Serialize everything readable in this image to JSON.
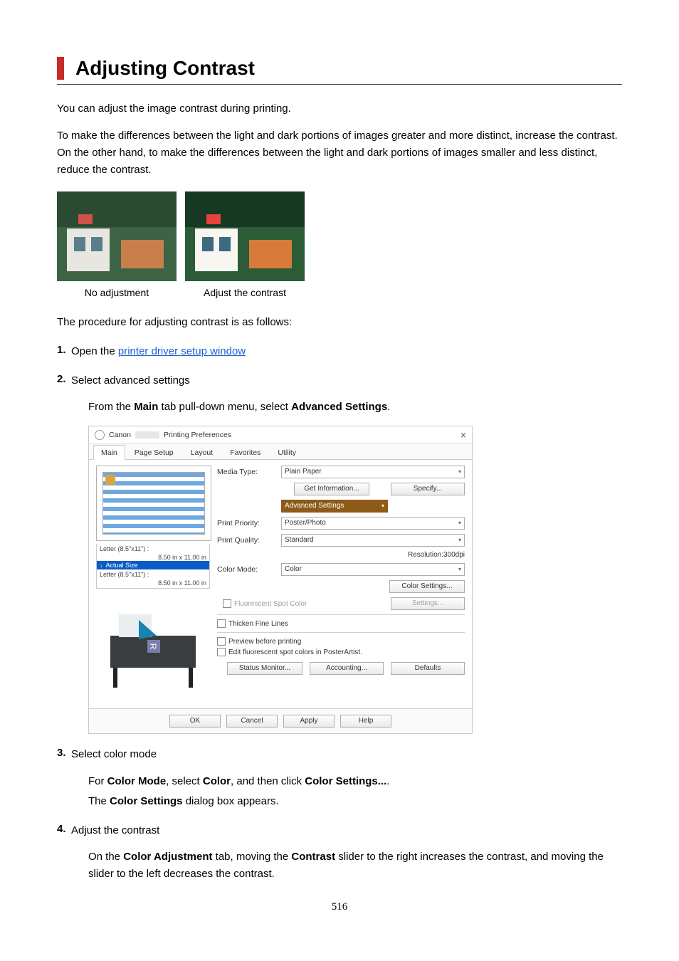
{
  "title": "Adjusting Contrast",
  "intro1": "You can adjust the image contrast during printing.",
  "intro2": "To make the differences between the light and dark portions of images greater and more distinct, increase the contrast. On the other hand, to make the differences between the light and dark portions of images smaller and less distinct, reduce the contrast.",
  "caption_no_adjust": "No adjustment",
  "caption_adjust": "Adjust the contrast",
  "procedure_intro": "The procedure for adjusting contrast is as follows:",
  "step1_prefix": "Open the ",
  "step1_link": "printer driver setup window",
  "step2_title": "Select advanced settings",
  "step2_sub_a": "From the ",
  "step2_sub_b": "Main",
  "step2_sub_c": " tab pull-down menu, select ",
  "step2_sub_d": "Advanced Settings",
  "step3_title": "Select color mode",
  "step3_sub_a": "For ",
  "step3_sub_b": "Color Mode",
  "step3_sub_c": ", select ",
  "step3_sub_d": "Color",
  "step3_sub_e": ", and then click ",
  "step3_sub_f": "Color Settings...",
  "step3_sub_g": ".",
  "step3_line2_a": "The ",
  "step3_line2_b": "Color Settings",
  "step3_line2_c": " dialog box appears.",
  "step4_title": "Adjust the contrast",
  "step4_sub_a": "On the ",
  "step4_sub_b": "Color Adjustment",
  "step4_sub_c": " tab, moving the ",
  "step4_sub_d": "Contrast",
  "step4_sub_e": " slider to the right increases the contrast, and moving the slider to the left decreases the contrast.",
  "page_number": "516",
  "dialog": {
    "brand": "Canon",
    "title": "Printing Preferences",
    "close": "×",
    "tabs": [
      "Main",
      "Page Setup",
      "Layout",
      "Favorites",
      "Utility"
    ],
    "media_type_lbl": "Media Type:",
    "media_type_val": "Plain Paper",
    "get_info": "Get Information...",
    "specify": "Specify...",
    "adv_settings": "Advanced Settings",
    "print_priority_lbl": "Print Priority:",
    "print_priority_val": "Poster/Photo",
    "print_quality_lbl": "Print Quality:",
    "print_quality_val": "Standard",
    "resolution": "Resolution:300dpi",
    "color_mode_lbl": "Color Mode:",
    "color_mode_val": "Color",
    "color_settings": "Color Settings...",
    "fluorescent": "Fluorescent Spot Color",
    "settings": "Settings...",
    "thicken": "Thicken Fine Lines",
    "preview_chk": "Preview before printing",
    "edit_fluor": "Edit fluorescent spot colors in PosterArtist.",
    "status_monitor": "Status Monitor...",
    "accounting": "Accounting...",
    "defaults": "Defaults",
    "ok": "OK",
    "cancel": "Cancel",
    "apply": "Apply",
    "help": "Help",
    "size1_lbl": "Letter (8.5\"x11\") :",
    "size1_val": "8.50 in x 11.00 in",
    "actual_size": "Actual Size",
    "size2_lbl": "Letter (8.5\"x11\") :",
    "size2_val": "8.50 in x 11.00 in"
  }
}
